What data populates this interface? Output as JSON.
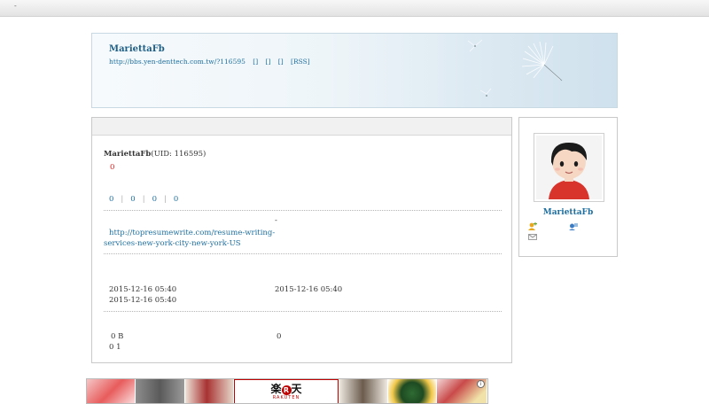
{
  "topbar": {
    "mark": "-"
  },
  "header": {
    "name": "MariettaFb",
    "url": "http://bbs.yen-denttech.com.tw/?116595",
    "link1": "[]",
    "link2": "[]",
    "link3": "[]",
    "rss": "[RSS]"
  },
  "profile": {
    "name": "MariettaFb",
    "uid_text": "(UID: 116595)",
    "score": "0",
    "stats": [
      "0",
      "0",
      "0",
      "0"
    ],
    "dash": "-",
    "homepage": "http://topresumewrite.com/resume-writing-",
    "homepage_cont": "services-new-york-city-new-york-US",
    "reg_time": "2015-12-16 05:40",
    "last_visit": "2015-12-16 05:40",
    "last_active": "2015-12-16 05:40",
    "space": "0 B",
    "posts_line": "0 1",
    "credit": "0"
  },
  "sidebar": {
    "name": "MariettaFb"
  },
  "ads": {
    "rakuten_jp": "楽",
    "rakuten_r": "R",
    "rakuten_jp2": "天",
    "rakuten_en": "RAKUTEN",
    "close": "i"
  }
}
